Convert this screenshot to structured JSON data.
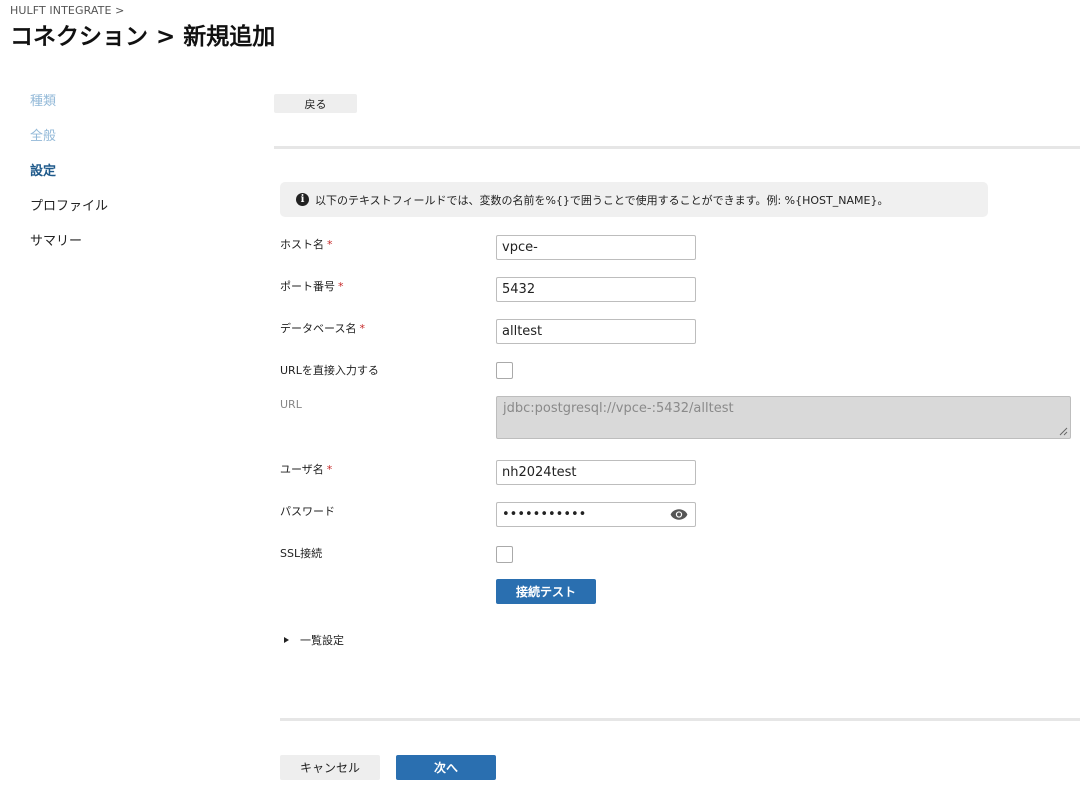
{
  "breadcrumb": "HULFT INTEGRATE >",
  "title": "コネクション > 新規追加",
  "steps": [
    {
      "label": "種類",
      "state": "done"
    },
    {
      "label": "全般",
      "state": "done"
    },
    {
      "label": "設定",
      "state": "active"
    },
    {
      "label": "プロファイル",
      "state": "todo"
    },
    {
      "label": "サマリー",
      "state": "todo"
    }
  ],
  "back_label": "戻る",
  "info_text": "以下のテキストフィールドでは、変数の名前を%{}で囲うことで使用することができます。例: %{HOST_NAME}。",
  "info_icon": "info-icon",
  "required_mark": "*",
  "fields": {
    "host": {
      "label": "ホスト名",
      "value": "vpce-"
    },
    "port": {
      "label": "ポート番号",
      "value": "5432"
    },
    "database": {
      "label": "データベース名",
      "value": "alltest"
    },
    "direct_url": {
      "label": "URLを直接入力する",
      "checked": false
    },
    "url": {
      "label": "URL",
      "value": "jdbc:postgresql://vpce-:5432/alltest"
    },
    "user": {
      "label": "ユーザ名",
      "value": "nh2024test"
    },
    "password": {
      "label": "パスワード",
      "value": "•••••••••••"
    },
    "ssl": {
      "label": "SSL接続",
      "checked": false
    }
  },
  "test_button": "接続テスト",
  "advanced_label": "一覧設定",
  "cancel_label": "キャンセル",
  "next_label": "次へ",
  "colors": {
    "primary": "#2a6fb0",
    "step_active": "#1f5a8b",
    "step_done": "#93b9d8",
    "required": "#c62828"
  }
}
